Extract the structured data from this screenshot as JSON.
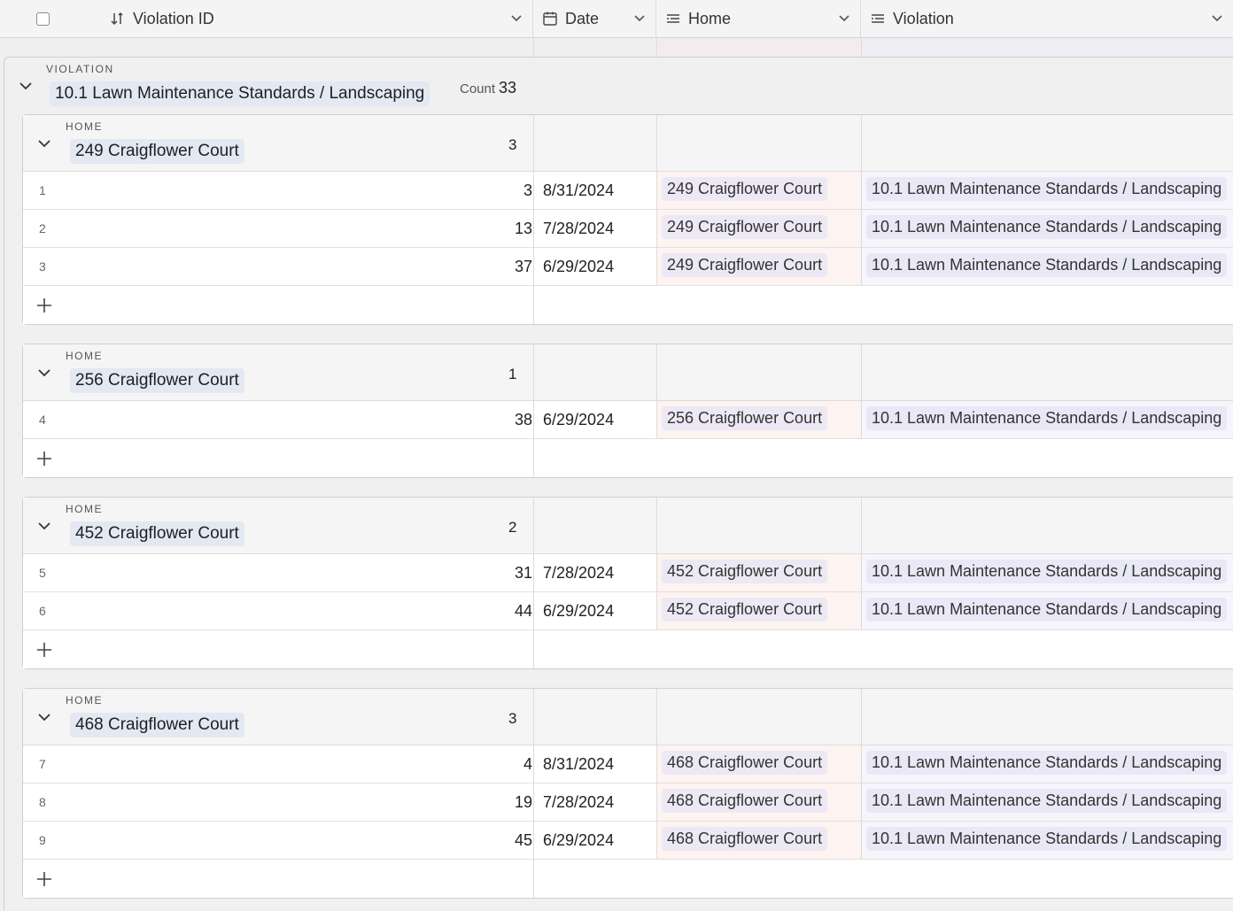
{
  "header": {
    "columns": [
      {
        "label": "Violation ID",
        "icon": "sort-icon"
      },
      {
        "label": "Date",
        "icon": "calendar-icon"
      },
      {
        "label": "Home",
        "icon": "linked-record-icon"
      },
      {
        "label": "Violation",
        "icon": "linked-record-icon"
      }
    ]
  },
  "group": {
    "type": "VIOLATION",
    "name": "10.1 Lawn Maintenance Standards / Landscaping",
    "count_label": "Count",
    "count": "33"
  },
  "subgroups": [
    {
      "type": "HOME",
      "name": "249 Craigflower Court",
      "count": "3",
      "rows": [
        {
          "index": "1",
          "id": "3",
          "date": "8/31/2024",
          "home": "249 Craigflower Court",
          "violation": "10.1 Lawn Maintenance Standards / Landscaping"
        },
        {
          "index": "2",
          "id": "13",
          "date": "7/28/2024",
          "home": "249 Craigflower Court",
          "violation": "10.1 Lawn Maintenance Standards / Landscaping"
        },
        {
          "index": "3",
          "id": "37",
          "date": "6/29/2024",
          "home": "249 Craigflower Court",
          "violation": "10.1 Lawn Maintenance Standards / Landscaping"
        }
      ]
    },
    {
      "type": "HOME",
      "name": "256 Craigflower Court",
      "count": "1",
      "rows": [
        {
          "index": "4",
          "id": "38",
          "date": "6/29/2024",
          "home": "256 Craigflower Court",
          "violation": "10.1 Lawn Maintenance Standards / Landscaping"
        }
      ]
    },
    {
      "type": "HOME",
      "name": "452 Craigflower Court",
      "count": "2",
      "rows": [
        {
          "index": "5",
          "id": "31",
          "date": "7/28/2024",
          "home": "452 Craigflower Court",
          "violation": "10.1 Lawn Maintenance Standards / Landscaping"
        },
        {
          "index": "6",
          "id": "44",
          "date": "6/29/2024",
          "home": "452 Craigflower Court",
          "violation": "10.1 Lawn Maintenance Standards / Landscaping"
        }
      ]
    },
    {
      "type": "HOME",
      "name": "468 Craigflower Court",
      "count": "3",
      "rows": [
        {
          "index": "7",
          "id": "4",
          "date": "8/31/2024",
          "home": "468 Craigflower Court",
          "violation": "10.1 Lawn Maintenance Standards / Landscaping"
        },
        {
          "index": "8",
          "id": "19",
          "date": "7/28/2024",
          "home": "468 Craigflower Court",
          "violation": "10.1 Lawn Maintenance Standards / Landscaping"
        },
        {
          "index": "9",
          "id": "45",
          "date": "6/29/2024",
          "home": "468 Craigflower Court",
          "violation": "10.1 Lawn Maintenance Standards / Landscaping"
        }
      ]
    }
  ],
  "colors": {
    "highlight": "#ffef00",
    "home_chip": "#ece9f5",
    "violation_chip": "#e9e8f6"
  }
}
